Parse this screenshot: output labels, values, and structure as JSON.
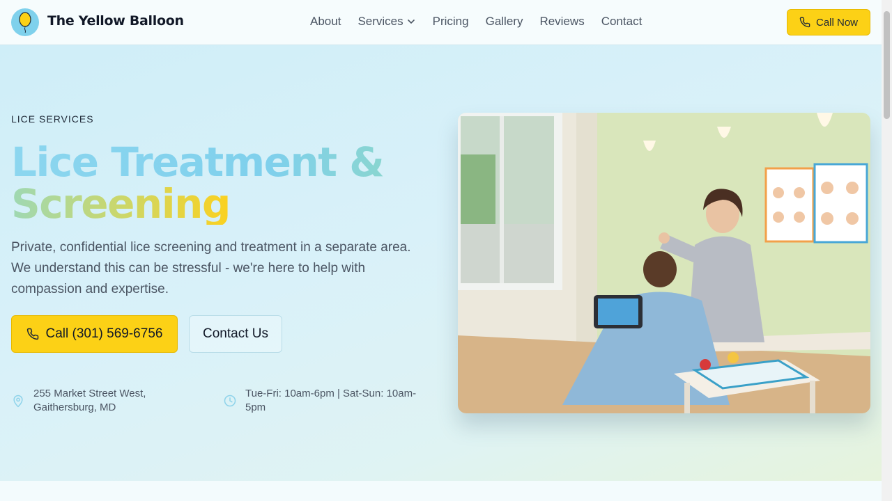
{
  "header": {
    "brand": "The Yellow Balloon",
    "nav": [
      {
        "label": "About"
      },
      {
        "label": "Services"
      },
      {
        "label": "Pricing"
      },
      {
        "label": "Gallery"
      },
      {
        "label": "Reviews"
      },
      {
        "label": "Contact"
      }
    ],
    "call_now": "Call Now"
  },
  "hero": {
    "eyebrow": "LICE SERVICES",
    "title_line1": "Lice Treatment &",
    "title_line2": "Screening",
    "description": "Private, confidential lice screening and treatment in a separate area. We understand this can be stressful - we're here to help with compassion and expertise.",
    "call_button": "Call (301) 569-6756",
    "contact_button": "Contact Us",
    "address": "255 Market Street West, Gaithersburg, MD",
    "hours": "Tue-Fri: 10am-6pm | Sat-Sun: 10am-5pm"
  },
  "colors": {
    "accent_yellow": "#fcd116",
    "accent_blue": "#7fd1ec",
    "text_dark": "#111827",
    "text_muted": "#4b5563"
  },
  "icons": [
    "balloon-icon",
    "chevron-down-icon",
    "phone-icon",
    "map-pin-icon",
    "clock-icon"
  ]
}
